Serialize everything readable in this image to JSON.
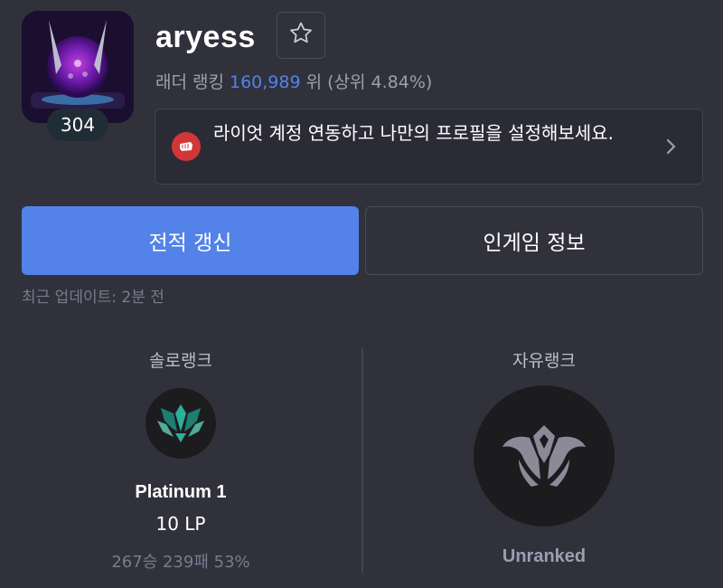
{
  "profile": {
    "level": "304",
    "name": "aryess",
    "ladder_prefix": "래더 랭킹 ",
    "ladder_rank": "160,989",
    "ladder_suffix": " 위 (상위 4.84%)",
    "icon": "profile-icon",
    "favorite_icon": "star-icon"
  },
  "riot_banner": {
    "text": "라이엇 계정 연동하고 나만의 프로필을 설정해보세요.",
    "icon": "riot-fist-icon",
    "arrow_icon": "chevron-right-icon"
  },
  "actions": {
    "update_label": "전적 갱신",
    "ingame_label": "인게임 정보",
    "last_updated": "최근 업데이트: 2분 전"
  },
  "ranks": {
    "solo": {
      "title": "솔로랭크",
      "tier": "Platinum 1",
      "lp": "10 LP",
      "record": "267승 239패 53%",
      "emblem": "platinum-emblem-icon"
    },
    "flex": {
      "title": "자유랭크",
      "tier": "Unranked",
      "emblem": "unranked-emblem-icon"
    }
  },
  "colors": {
    "background": "#31313c",
    "accent": "#5383e8",
    "riot_red": "#d13639",
    "muted": "#7b7a8e"
  }
}
